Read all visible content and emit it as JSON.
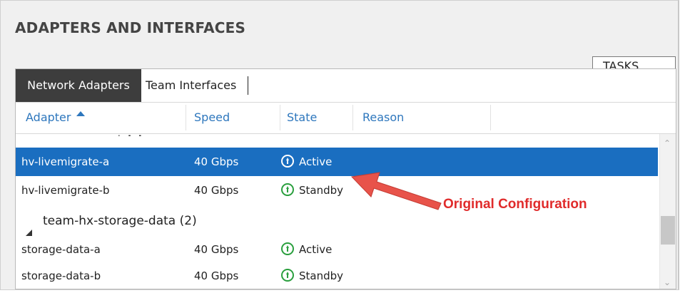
{
  "panel": {
    "title": "ADAPTERS AND INTERFACES",
    "tasks_label": "TASKS"
  },
  "tabs": [
    {
      "label": "Network Adapters",
      "active": true
    },
    {
      "label": "Team Interfaces",
      "active": false
    }
  ],
  "columns": {
    "adapter": "Adapter",
    "speed": "Speed",
    "state": "State",
    "reason": "Reason"
  },
  "rows": [
    {
      "adapter": "hv-livemigrate-a",
      "speed": "40 Gbps",
      "state": "Active",
      "selected": true
    },
    {
      "adapter": "hv-livemigrate-b",
      "speed": "40 Gbps",
      "state": "Standby"
    },
    {
      "adapter": "storage-data-a",
      "speed": "40 Gbps",
      "state": "Active"
    },
    {
      "adapter": "storage-data-b",
      "speed": "40 Gbps",
      "state": "Standby"
    }
  ],
  "group": {
    "label": "team-hx-storage-data (2)"
  },
  "annotation": {
    "text": "Original Configuration",
    "color": "#e02b2b"
  },
  "colors": {
    "selection": "#1a6ec0",
    "header_text": "#2e77bd",
    "status_green": "#2a9f3e",
    "tab_active_bg": "#3d3d3d"
  },
  "icons": [
    "sort-ascending-icon",
    "status-up-arrow-icon",
    "collapse-triangle-icon",
    "dropdown-caret-icon",
    "scroll-up-icon",
    "scroll-down-icon"
  ]
}
